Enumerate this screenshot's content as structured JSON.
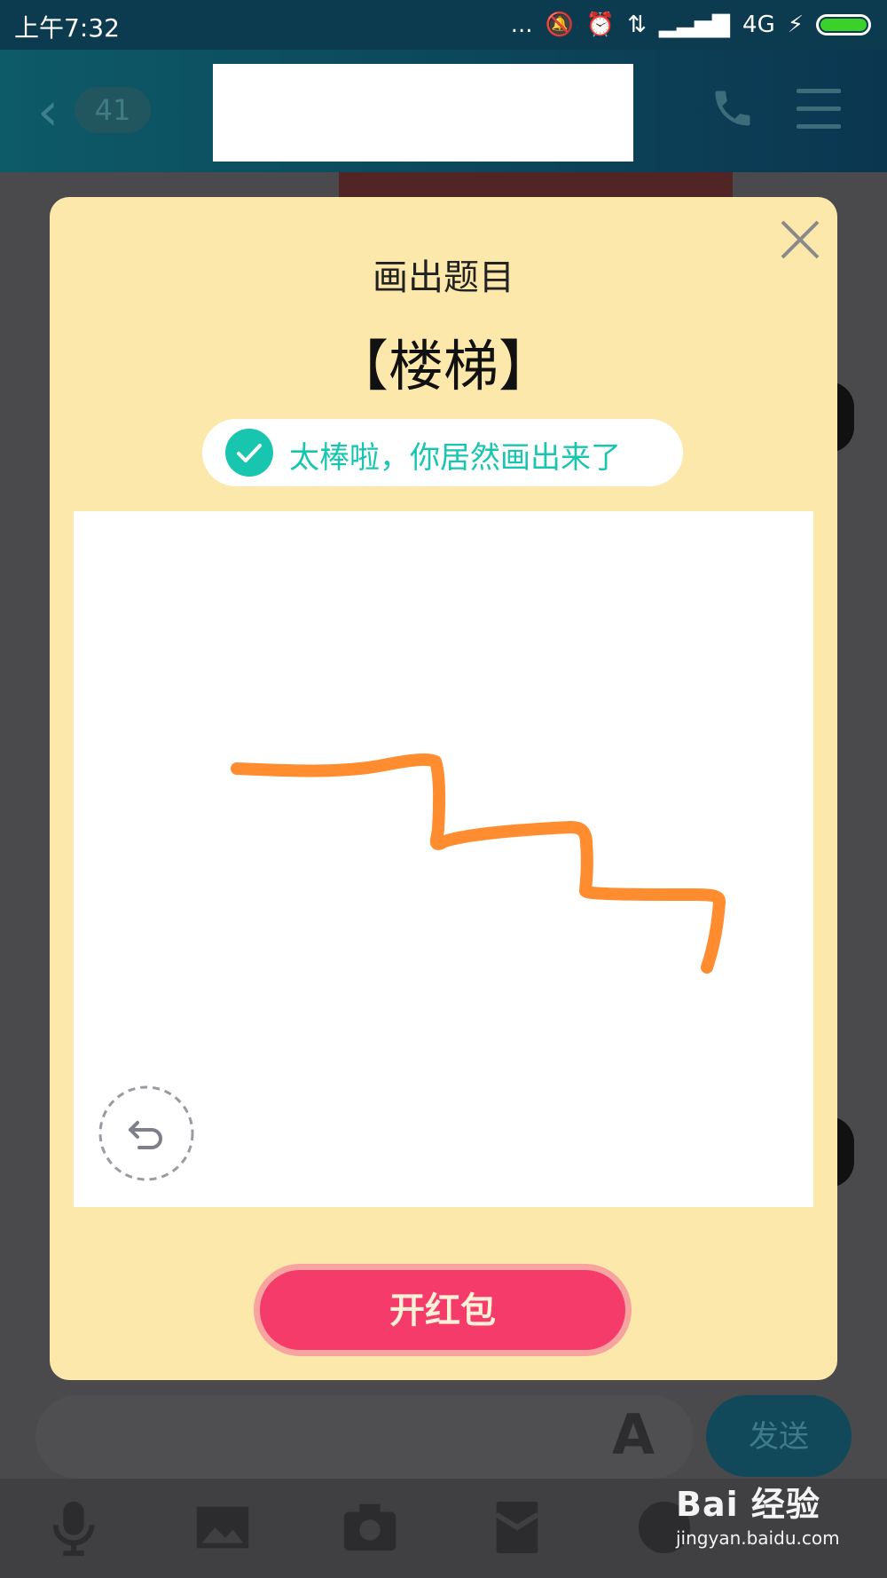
{
  "status_bar": {
    "time": "上午7:32",
    "dots": "...",
    "network": "4G"
  },
  "header": {
    "back_icon": "chevron-left-icon",
    "unread_count": "41",
    "phone_icon": "phone-icon",
    "menu_icon": "menu-icon"
  },
  "modal": {
    "title": "画出题目",
    "word": "【楼梯】",
    "success_message": "太棒啦，你居然画出来了",
    "close_icon": "close-icon",
    "undo_icon": "undo-icon",
    "open_button_label": "开红包",
    "stroke_color": "#ff8c2e",
    "button_color": "#f53b6a",
    "success_color": "#18c6b0"
  },
  "composer": {
    "font_icon": "font-style-icon",
    "send_label": "发送"
  },
  "toolbar": {
    "items": [
      "microphone-icon",
      "image-icon",
      "camera-icon",
      "red-packet-icon",
      "emoji-icon"
    ]
  },
  "watermark": {
    "logo": "Bai 经验",
    "url": "jingyan.baidu.com"
  }
}
